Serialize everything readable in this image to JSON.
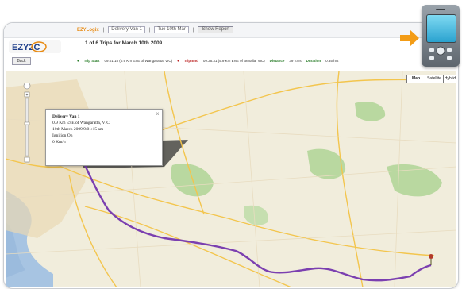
{
  "topbar": {
    "brand": "EZYLogix",
    "vehicle_select": "Delivery Van 1",
    "date_select": "Tue 10th Mar",
    "show_button": "Show Report"
  },
  "header": {
    "logo_text": "EZY2C",
    "title": "1 of 6 Trips for March 10th 2009",
    "back_button": "Back"
  },
  "trip": {
    "start_label": "Trip Start",
    "start_value": "09:01:15 (0.9 Km ESE of Wangaratta, VIC)",
    "end_label": "Trip End",
    "end_value": "09:36:31 (5.9 Km ENE of Benalla, VIC)",
    "distance_label": "Distance",
    "distance_value": "39 Kms",
    "duration_label": "Duration",
    "duration_value": "0:35 hrs"
  },
  "map": {
    "type_buttons": [
      "Map",
      "Satellite",
      "Hybrid"
    ],
    "popup": {
      "title": "Delivery Van 1",
      "line1": "0.9 Km ESE of Wangaratta, VIC",
      "line2": "10th March 2009 9:01:15 am",
      "line3": "Ignition On",
      "line4": "0 Km/h",
      "close": "x"
    }
  },
  "colors": {
    "accent": "#e88a12",
    "route": "#7b3fb0",
    "water": "#a7c4e2",
    "park": "#b9d8a0",
    "road": "#f3c54d"
  },
  "icons": [
    "phone-icon",
    "arrow-icon",
    "start-pin-icon",
    "end-pin-icon",
    "zoom-plus-icon",
    "zoom-minus-icon",
    "pan-icon",
    "close-icon"
  ]
}
